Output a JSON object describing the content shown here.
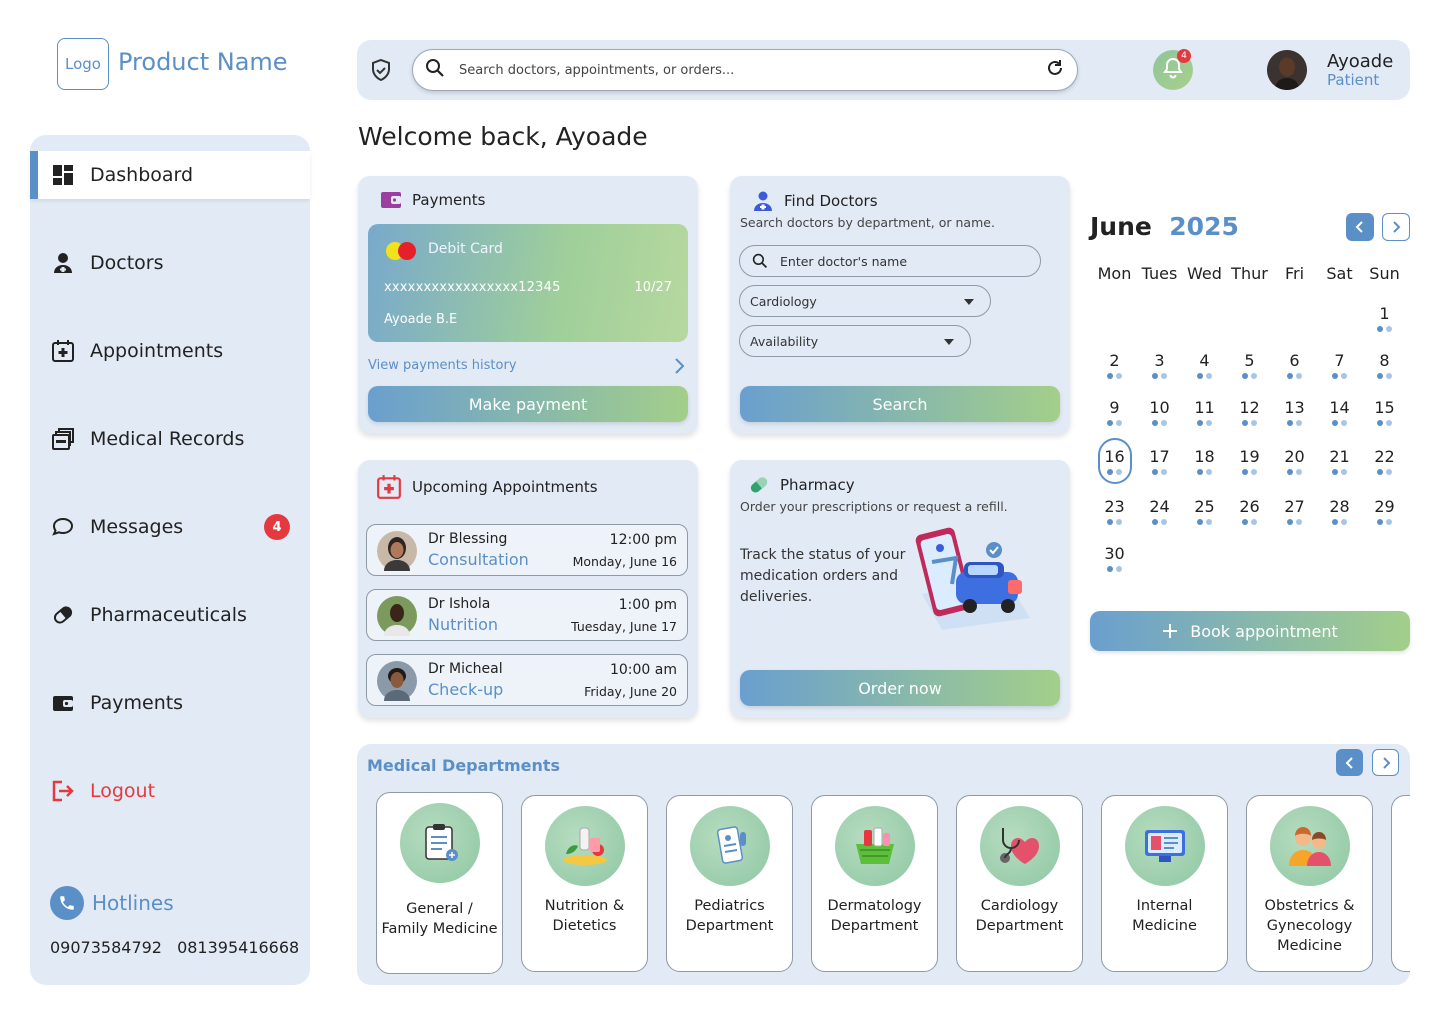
{
  "brand": {
    "logo": "Logo",
    "product_name": "Product Name"
  },
  "sidebar": {
    "items": [
      {
        "label": "Dashboard",
        "icon": "dashboard-icon"
      },
      {
        "label": "Doctors",
        "icon": "doctor-icon"
      },
      {
        "label": "Appointments",
        "icon": "calendar-plus-icon"
      },
      {
        "label": "Medical Records",
        "icon": "records-icon"
      },
      {
        "label": "Messages",
        "icon": "chat-icon",
        "badge": "4"
      },
      {
        "label": "Pharmaceuticals",
        "icon": "pill-icon"
      },
      {
        "label": "Payments",
        "icon": "wallet-icon"
      },
      {
        "label": "Logout",
        "icon": "logout-icon"
      }
    ],
    "hotlines": {
      "label": "Hotlines",
      "numbers": "09073584792 081395416668"
    }
  },
  "topbar": {
    "search_placeholder": "Search doctors, appointments, or orders...",
    "notification_count": "4",
    "user": {
      "name": "Ayoade",
      "role": "Patient"
    }
  },
  "welcome": "Welcome back, Ayoade",
  "payments": {
    "title": "Payments",
    "card_type": "Debit Card",
    "card_number": "xxxxxxxxxxxxxxxxx12345",
    "expiry": "10/27",
    "holder": "Ayoade B.E",
    "history_link": "View payments history",
    "button": "Make payment"
  },
  "find_doctors": {
    "title": "Find Doctors",
    "subtitle": "Search doctors by department, or name.",
    "name_placeholder": "Enter doctor's name",
    "department": "Cardiology",
    "availability": "Availability",
    "button": "Search"
  },
  "appointments": {
    "title": "Upcoming Appointments",
    "items": [
      {
        "doctor": "Dr Blessing",
        "type": "Consultation",
        "time": "12:00 pm",
        "date": "Monday, June 16"
      },
      {
        "doctor": "Dr Ishola",
        "type": "Nutrition",
        "time": "1:00 pm",
        "date": "Tuesday, June 17"
      },
      {
        "doctor": "Dr Micheal",
        "type": "Check-up",
        "time": "10:00 am",
        "date": "Friday, June 20"
      }
    ]
  },
  "pharmacy": {
    "title": "Pharmacy",
    "subtitle": "Order your prescriptions or request a refill.",
    "body": "Track the status of your medication orders and deliveries.",
    "button": "Order now"
  },
  "calendar": {
    "month": "June",
    "year": "2025",
    "weekdays": [
      "Mon",
      "Tues",
      "Wed",
      "Thur",
      "Fri",
      "Sat",
      "Sun"
    ],
    "today": "16",
    "button": "Book appointment"
  },
  "departments": {
    "title": "Medical Departments",
    "items": [
      {
        "label": "General / Family Medicine"
      },
      {
        "label": "Nutrition & Dietetics"
      },
      {
        "label": "Pediatrics Department"
      },
      {
        "label": "Dermatology Department"
      },
      {
        "label": "Cardiology Department"
      },
      {
        "label": "Internal Medicine"
      },
      {
        "label": "Obstetrics & Gynecology Medicine"
      }
    ]
  },
  "colors": {
    "accent": "#5b8fc7",
    "panel": "#e2ebf5",
    "danger": "#e53940",
    "green": "#a3cf8a"
  }
}
